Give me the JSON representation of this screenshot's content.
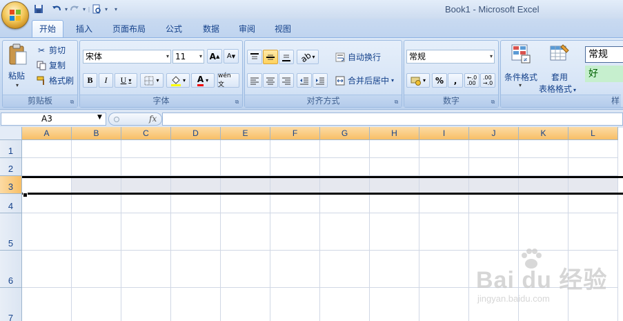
{
  "window": {
    "title": "Book1 - Microsoft Excel"
  },
  "quick_access": {
    "save_icon": "save-icon",
    "undo_icon": "undo-icon",
    "redo_icon": "redo-icon",
    "print_preview_icon": "print-preview-icon",
    "customize_label": "▾"
  },
  "tabs": [
    {
      "label": "开始",
      "active": true
    },
    {
      "label": "插入"
    },
    {
      "label": "页面布局"
    },
    {
      "label": "公式"
    },
    {
      "label": "数据"
    },
    {
      "label": "审阅"
    },
    {
      "label": "视图"
    }
  ],
  "ribbon": {
    "clipboard": {
      "label": "剪贴板",
      "paste": "粘贴",
      "cut": "剪切",
      "copy": "复制",
      "format_painter": "格式刷"
    },
    "font": {
      "label": "字体",
      "font_name": "宋体",
      "font_size": "11",
      "bold": "B",
      "italic": "I",
      "underline": "U",
      "grow": "A",
      "shrink": "A",
      "font_color_letter": "A",
      "phonetic": "wén 文"
    },
    "alignment": {
      "label": "对齐方式",
      "wrap_text": "自动换行",
      "merge_center": "合并后居中"
    },
    "number": {
      "label": "数字",
      "format": "常规",
      "percent": "%",
      "comma": ",",
      "inc_decimal": "←.0\n.00",
      "dec_decimal": ".00\n→.0"
    },
    "styles": {
      "label": "样",
      "conditional_formatting": "条件格式",
      "format_as_table_1": "套用",
      "format_as_table_2": "表格格式",
      "style_normal": "常规",
      "style_good": "好"
    }
  },
  "formula_bar": {
    "name_box": "A3",
    "fx": "fx",
    "formula": ""
  },
  "columns": [
    "A",
    "B",
    "C",
    "D",
    "E",
    "F",
    "G",
    "H",
    "I",
    "J",
    "K",
    "L"
  ],
  "rows": [
    "1",
    "2",
    "3",
    "4",
    "5",
    "6",
    "7"
  ],
  "selection": {
    "row": "3",
    "active_cell": "A3"
  },
  "watermark": {
    "main": "Bai du 经验",
    "sub": "jingyan.baidu.com"
  },
  "colors": {
    "ribbon_bg": "#c7daf2",
    "selected_header": "#f8bf66",
    "grid_line": "#d0d7e5"
  }
}
